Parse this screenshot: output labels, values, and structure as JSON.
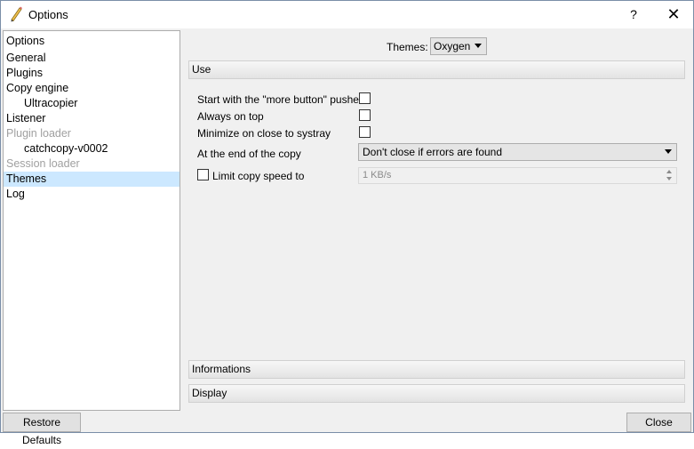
{
  "window": {
    "title": "Options",
    "help_glyph": "?",
    "close_glyph": "✕",
    "icon": "pencil-icon"
  },
  "sidebar": {
    "items": [
      {
        "label": "Options",
        "state": "normal"
      },
      {
        "label": "General",
        "state": "normal"
      },
      {
        "label": "Plugins",
        "state": "normal"
      },
      {
        "label": "Copy engine",
        "state": "normal"
      },
      {
        "label": "Ultracopier",
        "state": "normal"
      },
      {
        "label": "Listener",
        "state": "normal"
      },
      {
        "label": "Plugin loader",
        "state": "disabled"
      },
      {
        "label": "catchcopy-v0002",
        "state": "normal"
      },
      {
        "label": "Session loader",
        "state": "disabled"
      },
      {
        "label": "Themes",
        "state": "selected"
      },
      {
        "label": "Log",
        "state": "normal"
      }
    ]
  },
  "themes": {
    "label": "Themes:",
    "selected": "Oxygen"
  },
  "sections": {
    "use": "Use",
    "informations": "Informations",
    "display": "Display"
  },
  "options": {
    "more_button_label": "Start with the \"more button\" pushed",
    "more_button_checked": false,
    "always_on_top_label": "Always on top",
    "always_on_top_checked": false,
    "minimize_label": "Minimize on close to systray",
    "minimize_checked": false,
    "end_of_copy_label": "At the end of the copy",
    "end_of_copy_value": "Don't close if errors are found",
    "limit_speed_label": "Limit copy speed to",
    "limit_speed_checked": false,
    "speed_value": "1 KB/s"
  },
  "buttons": {
    "restore_defaults": "Restore Defaults",
    "close": "Close"
  }
}
